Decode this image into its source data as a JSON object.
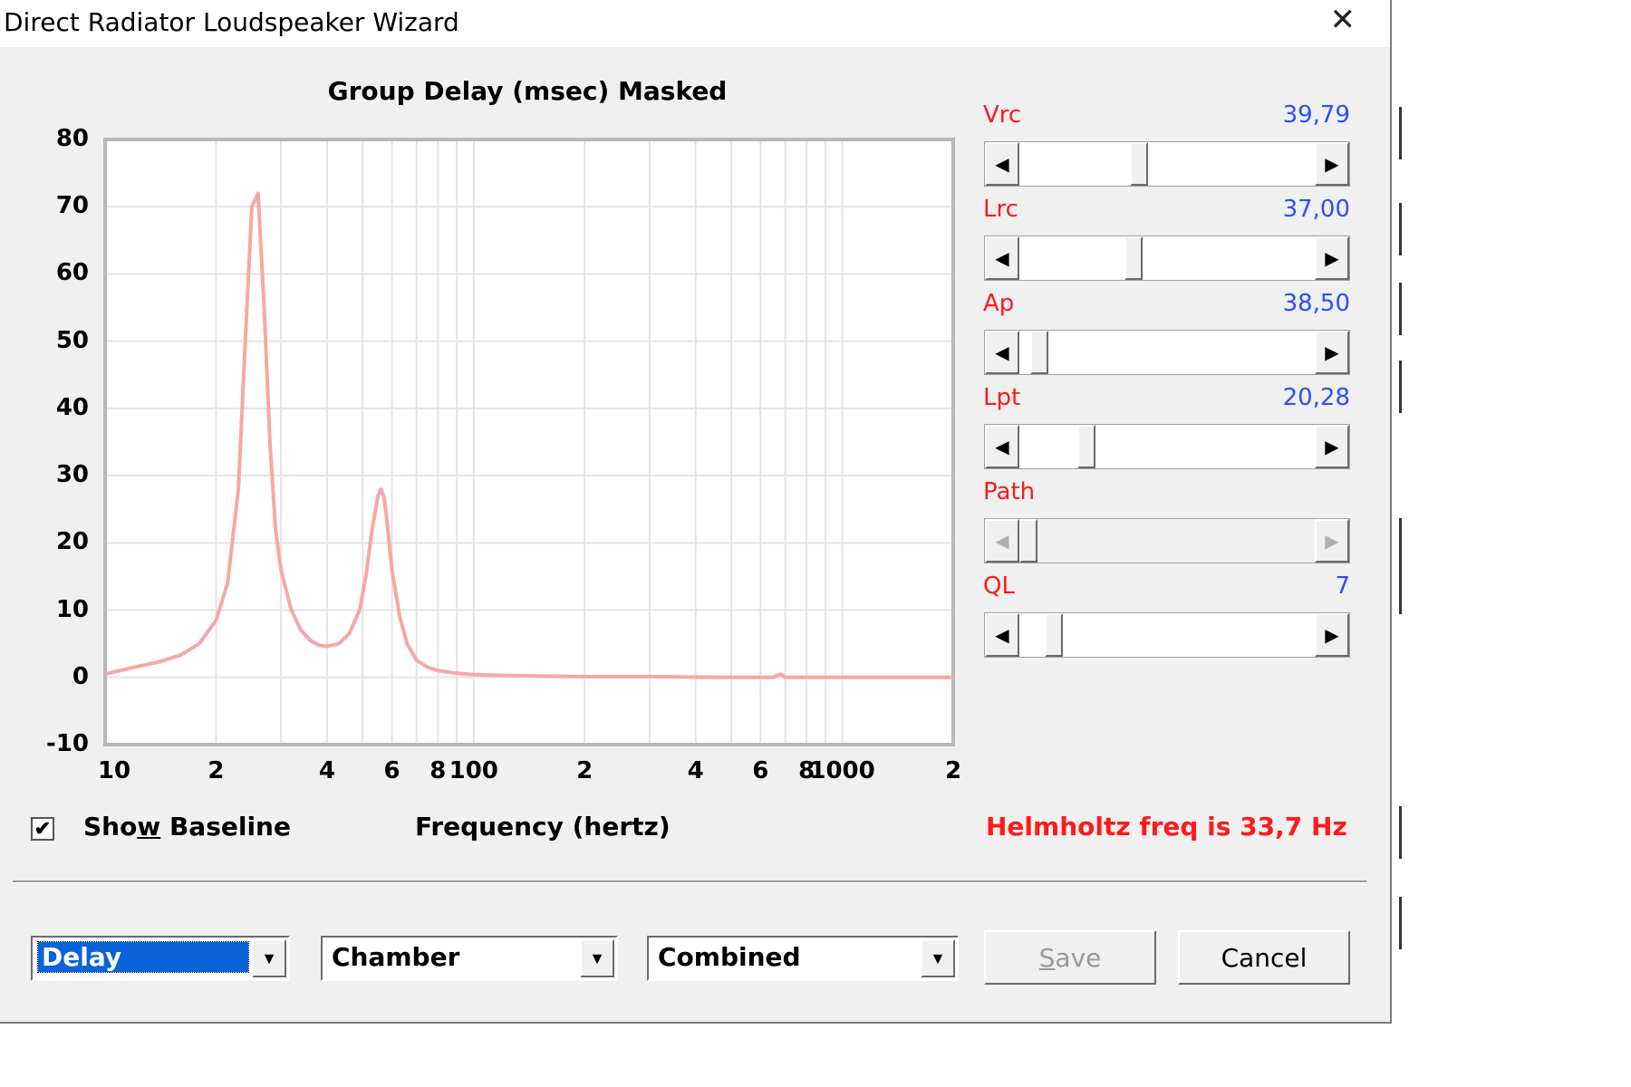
{
  "window": {
    "title": "Direct Radiator Loudspeaker Wizard"
  },
  "chart_data": {
    "type": "line",
    "title": "Group Delay (msec)   Masked",
    "xlabel": "Frequency (hertz)",
    "ylabel": "",
    "x_scale": "log",
    "xlim": [
      10,
      2000
    ],
    "ylim": [
      -10,
      80
    ],
    "grid": true,
    "y_ticks": [
      "80",
      "70",
      "60",
      "50",
      "40",
      "30",
      "20",
      "10",
      "0",
      "-10"
    ],
    "x_ticks": [
      "10",
      "2",
      "4",
      "6",
      "8",
      "100",
      "2",
      "4",
      "6",
      "8",
      "1000",
      "2"
    ],
    "series": [
      {
        "color": "#f7a7a7",
        "x": [
          10,
          12,
          14,
          16,
          18,
          20,
          21.5,
          23,
          24,
          25,
          26,
          27,
          28,
          29,
          30,
          32,
          34,
          36,
          38,
          40,
          43,
          46,
          49,
          51,
          53,
          55,
          56,
          57,
          58,
          60,
          63,
          66,
          70,
          75,
          80,
          90,
          100,
          120,
          150,
          200,
          300,
          500,
          650,
          680,
          700,
          800,
          1000,
          1500,
          2000
        ],
        "y": [
          0.5,
          1.5,
          2.3,
          3.3,
          5.0,
          8.5,
          14,
          28,
          50,
          70,
          72,
          55,
          35,
          22,
          16,
          10,
          7,
          5.5,
          4.8,
          4.6,
          5.0,
          6.5,
          10,
          15,
          22,
          27,
          28,
          27,
          24,
          16,
          9,
          5,
          2.5,
          1.5,
          1.0,
          0.6,
          0.4,
          0.3,
          0.2,
          0.1,
          0.1,
          0.0,
          0.0,
          0.5,
          0.0,
          0.0,
          0.0,
          0.0,
          0.0
        ]
      }
    ]
  },
  "sliders": [
    {
      "label": "Vrc",
      "value": "39,79",
      "position": 0.4,
      "enabled": true
    },
    {
      "label": "Lrc",
      "value": "37,00",
      "position": 0.38,
      "enabled": true
    },
    {
      "label": "Ap",
      "value": "38,50",
      "position": 0.04,
      "enabled": true
    },
    {
      "label": "Lpt",
      "value": "20,28",
      "position": 0.21,
      "enabled": true
    },
    {
      "label": "Path",
      "value": "",
      "position": 0.0,
      "enabled": false
    },
    {
      "label": "QL",
      "value": "7",
      "position": 0.09,
      "enabled": true
    }
  ],
  "options": {
    "show_baseline": {
      "label_pre": "Sho",
      "label_u": "w",
      "label_post": " Baseline",
      "checked": true,
      "mark": "✔"
    },
    "helmholtz": "Helmholtz freq is 33,7 Hz"
  },
  "combos": [
    {
      "value": "Delay",
      "selected": true
    },
    {
      "value": "Chamber",
      "selected": false
    },
    {
      "value": "Combined",
      "selected": false
    }
  ],
  "buttons": {
    "save_u": "S",
    "save_rest": "ave",
    "cancel": "Cancel"
  },
  "colors": {
    "label_red": "#ff1a1a",
    "value_blue": "#2a4fff",
    "curve": "#f7a7a7"
  }
}
